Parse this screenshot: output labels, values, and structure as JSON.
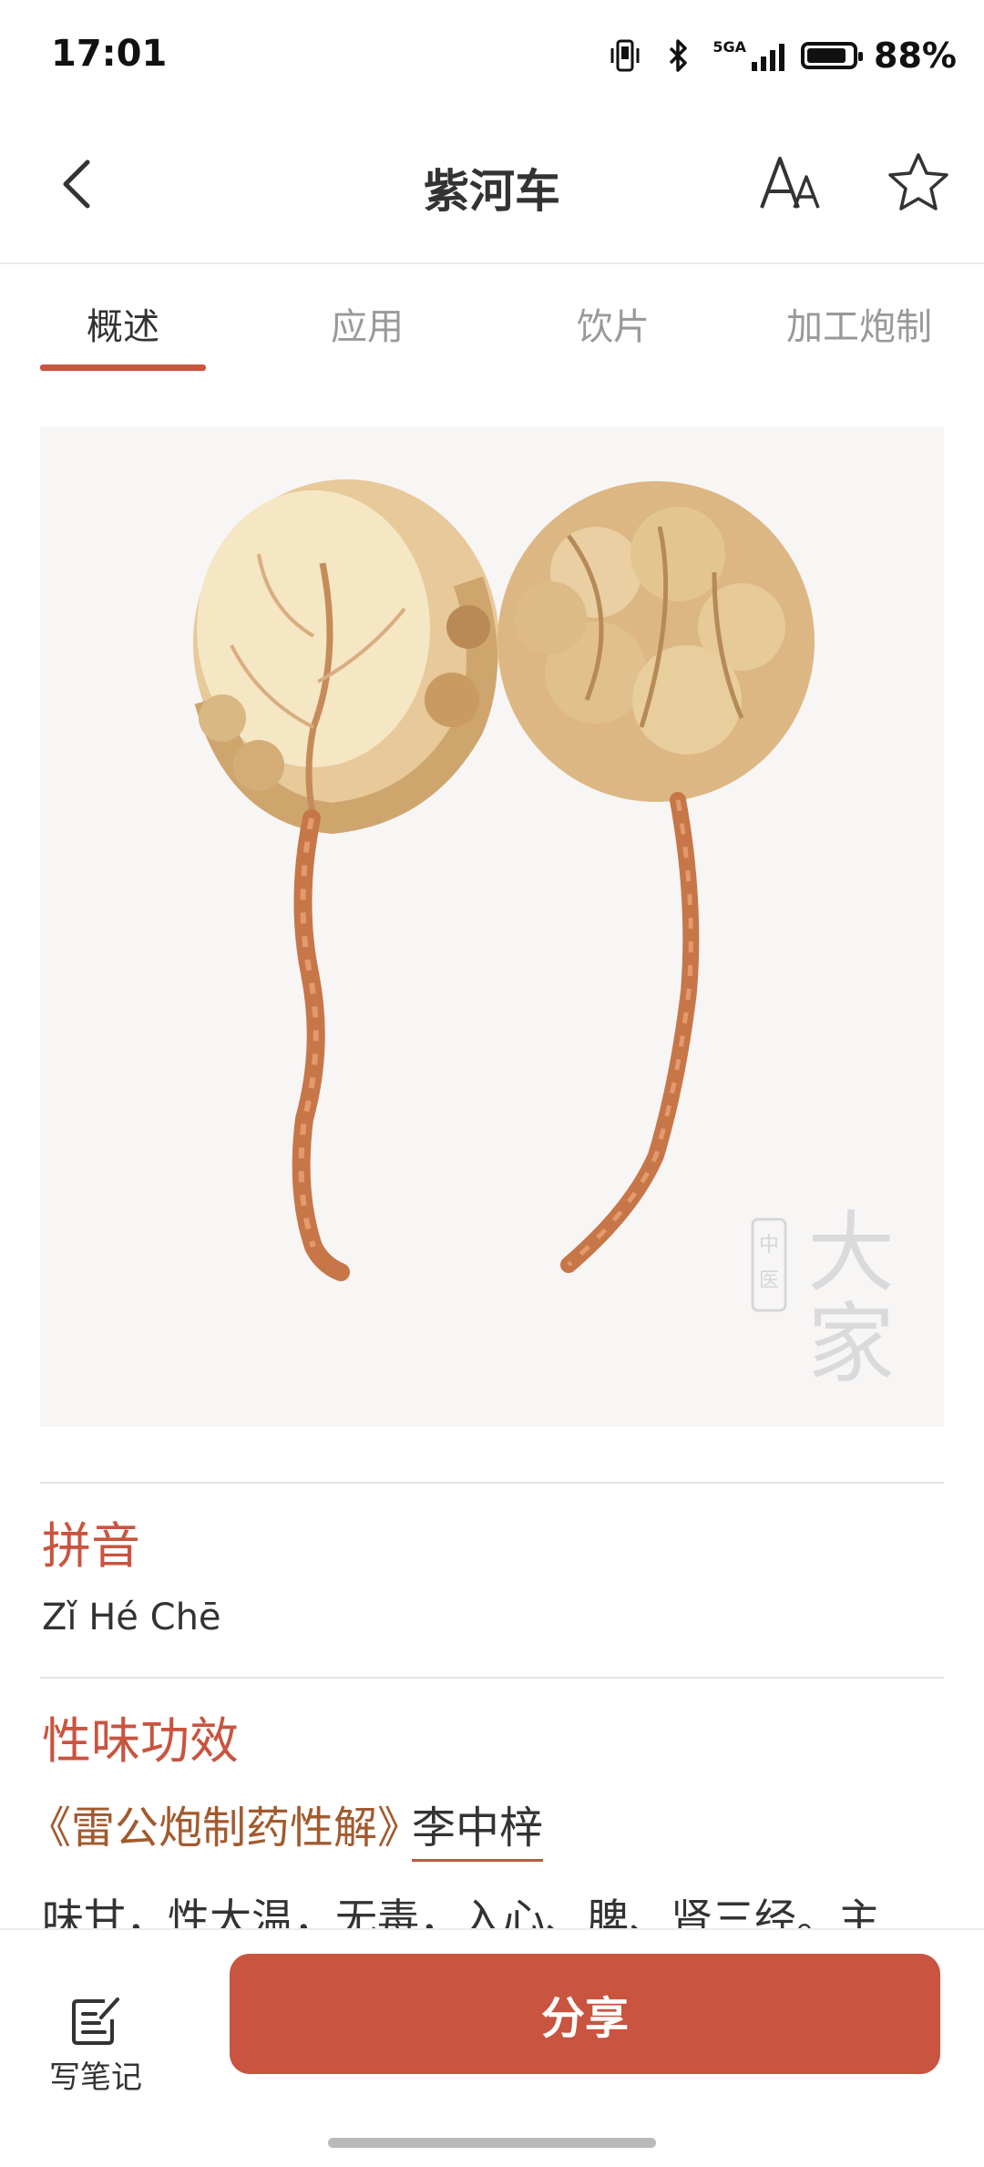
{
  "status_bar": {
    "time": "17:01",
    "network": "5GA",
    "battery_percent": "88%",
    "battery_level": 0.88,
    "icons": [
      "vibrate-icon",
      "bluetooth-icon",
      "signal-icon",
      "battery-icon"
    ]
  },
  "nav": {
    "title": "紫河车",
    "icons": [
      "back-icon",
      "font-size-icon",
      "star-icon"
    ]
  },
  "tabs": [
    {
      "label": "概述",
      "active": true
    },
    {
      "label": "应用",
      "active": false
    },
    {
      "label": "饮片",
      "active": false
    },
    {
      "label": "加工炮制",
      "active": false
    }
  ],
  "image": {
    "watermark_logo": "中医大家"
  },
  "sections": {
    "pinyin_title": "拼音",
    "pinyin_value": "Zǐ Hé Chē",
    "property_title": "性味功效",
    "source_book": "《雷公炮制药性解》",
    "source_author": "李中梓",
    "body": "味甘，性大温，无毒，入心、脾、肾三经。主"
  },
  "bottom_bar": {
    "note_label": "写笔记",
    "share_label": "分享"
  },
  "colors": {
    "accent": "#c9543f",
    "book_title": "#a25a2e",
    "inactive_tab": "#999999"
  }
}
